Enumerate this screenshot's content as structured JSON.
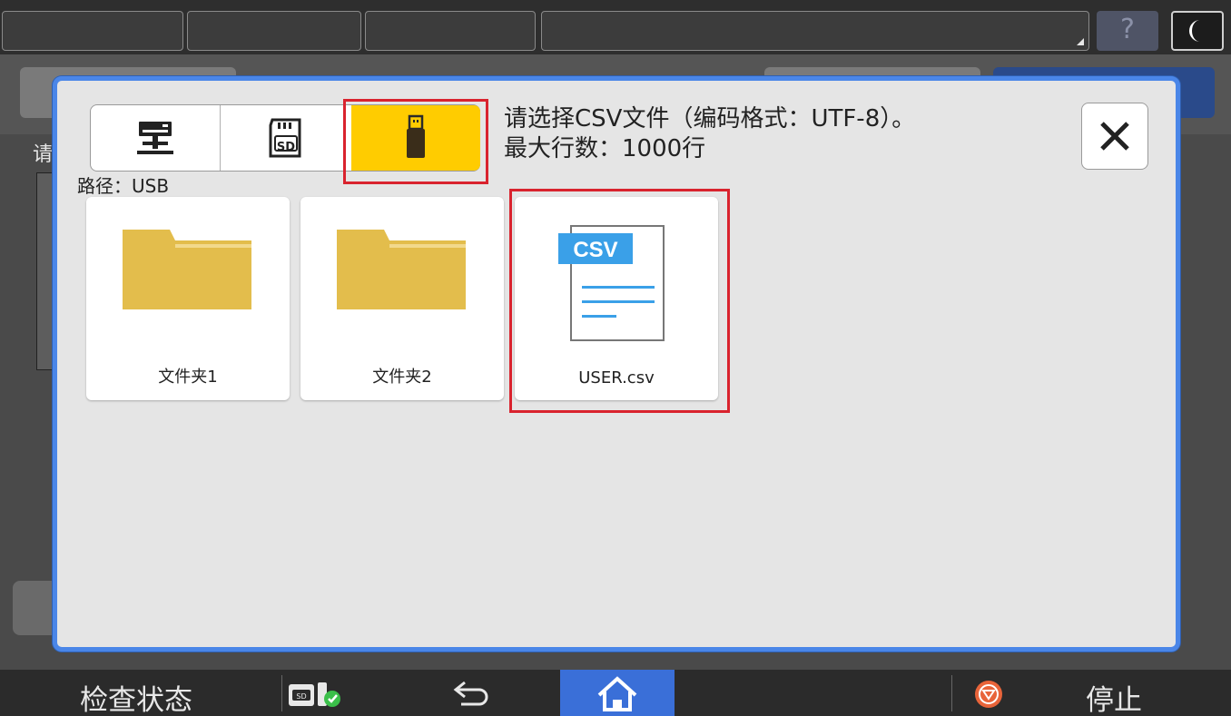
{
  "topbar": {
    "help_label": "?"
  },
  "background": {
    "left_text": "请"
  },
  "bottombar": {
    "check_status": "检查状态",
    "stop": "停止"
  },
  "modal": {
    "message_line1": "请选择CSV文件（编码格式：UTF-8）。",
    "message_line2": "最大行数：1000行",
    "path": "路径：USB",
    "sources": [
      {
        "name": "network",
        "selected": false
      },
      {
        "name": "sd",
        "label": "SD",
        "selected": false
      },
      {
        "name": "usb",
        "selected": true
      }
    ],
    "items": [
      {
        "type": "folder",
        "label": "文件夹1"
      },
      {
        "type": "folder",
        "label": "文件夹2"
      },
      {
        "type": "file",
        "label": "USER.csv",
        "badge": "CSV"
      }
    ]
  },
  "colors": {
    "accent_blue": "#4a86e8",
    "selected_yellow": "#ffcc00",
    "folder": "#e3bd4c",
    "csv_blue": "#3aa0e8",
    "highlight_red": "#d9232e"
  }
}
